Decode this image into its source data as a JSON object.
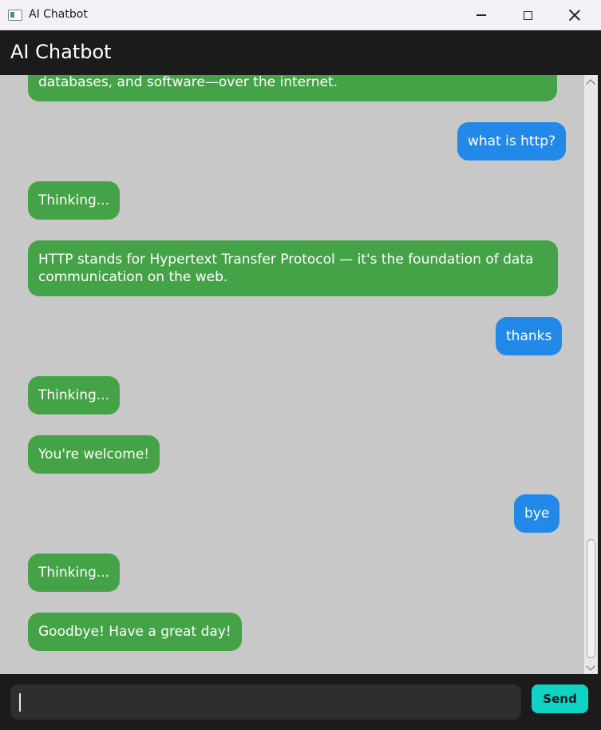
{
  "window": {
    "title": "AI Chatbot",
    "app_icon": "window-app-icon",
    "controls": [
      "minimize-icon",
      "maximize-icon",
      "close-icon"
    ]
  },
  "header": {
    "title": "AI Chatbot"
  },
  "messages": [
    {
      "role": "bot",
      "text": "databases, and software—over the internet."
    },
    {
      "role": "user",
      "text": "what is http?"
    },
    {
      "role": "bot",
      "text": "Thinking..."
    },
    {
      "role": "bot",
      "line1": "HTTP stands for Hypertext Transfer Protocol — it's the foundation of data",
      "line2": "communication on the web."
    },
    {
      "role": "user",
      "text": "thanks"
    },
    {
      "role": "bot",
      "text": "Thinking..."
    },
    {
      "role": "bot",
      "text": "You're welcome!"
    },
    {
      "role": "user",
      "text": "bye"
    },
    {
      "role": "bot",
      "text": "Thinking..."
    },
    {
      "role": "bot",
      "text": "Goodbye! Have a great day!"
    }
  ],
  "input": {
    "value": "",
    "send_label": "Send"
  },
  "colors": {
    "bot_bubble": "#45a347",
    "user_bubble": "#2389e8",
    "chat_background": "#c8c8c8",
    "header_background": "#1b1b1b",
    "send_button": "#0fd4c4"
  }
}
